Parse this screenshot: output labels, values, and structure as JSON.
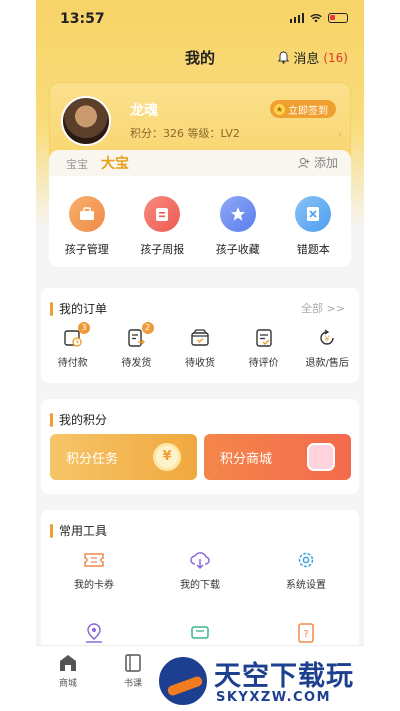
{
  "status": {
    "time": "13:57"
  },
  "nav": {
    "title": "我的",
    "message_label": "消息",
    "message_count": "(16)"
  },
  "profile": {
    "name": "龙魂",
    "info": "积分：326  等级：LV2",
    "signin_label": "立即签到"
  },
  "kids": {
    "tabs": [
      "宝宝",
      "大宝"
    ],
    "add_label": "添加"
  },
  "kid_menu": [
    {
      "label": "孩子管理",
      "icon": "briefcase-icon",
      "color": "#f49a52"
    },
    {
      "label": "孩子周报",
      "icon": "report-icon",
      "color": "#f0685e"
    },
    {
      "label": "孩子收藏",
      "icon": "star-icon",
      "color": "#6b8cf0"
    },
    {
      "label": "错题本",
      "icon": "notebook-icon",
      "color": "#5aa6f0"
    }
  ],
  "orders": {
    "title": "我的订单",
    "all_label": "全部 >>",
    "items": [
      {
        "label": "待付款",
        "badge": "3"
      },
      {
        "label": "待发货",
        "badge": "2"
      },
      {
        "label": "待收货"
      },
      {
        "label": "待评价"
      },
      {
        "label": "退款/售后"
      }
    ]
  },
  "points": {
    "title": "我的积分",
    "task_label": "积分任务",
    "shop_label": "积分商城",
    "coin_symbol": "¥"
  },
  "tools": {
    "title": "常用工具",
    "items": [
      {
        "label": "我的卡券"
      },
      {
        "label": "我的下载"
      },
      {
        "label": "系统设置"
      }
    ]
  },
  "tabbar": {
    "items": [
      "商城",
      "书课"
    ]
  },
  "watermark": {
    "cn": "天空下载玩",
    "en": "SKYXZW.COM"
  }
}
